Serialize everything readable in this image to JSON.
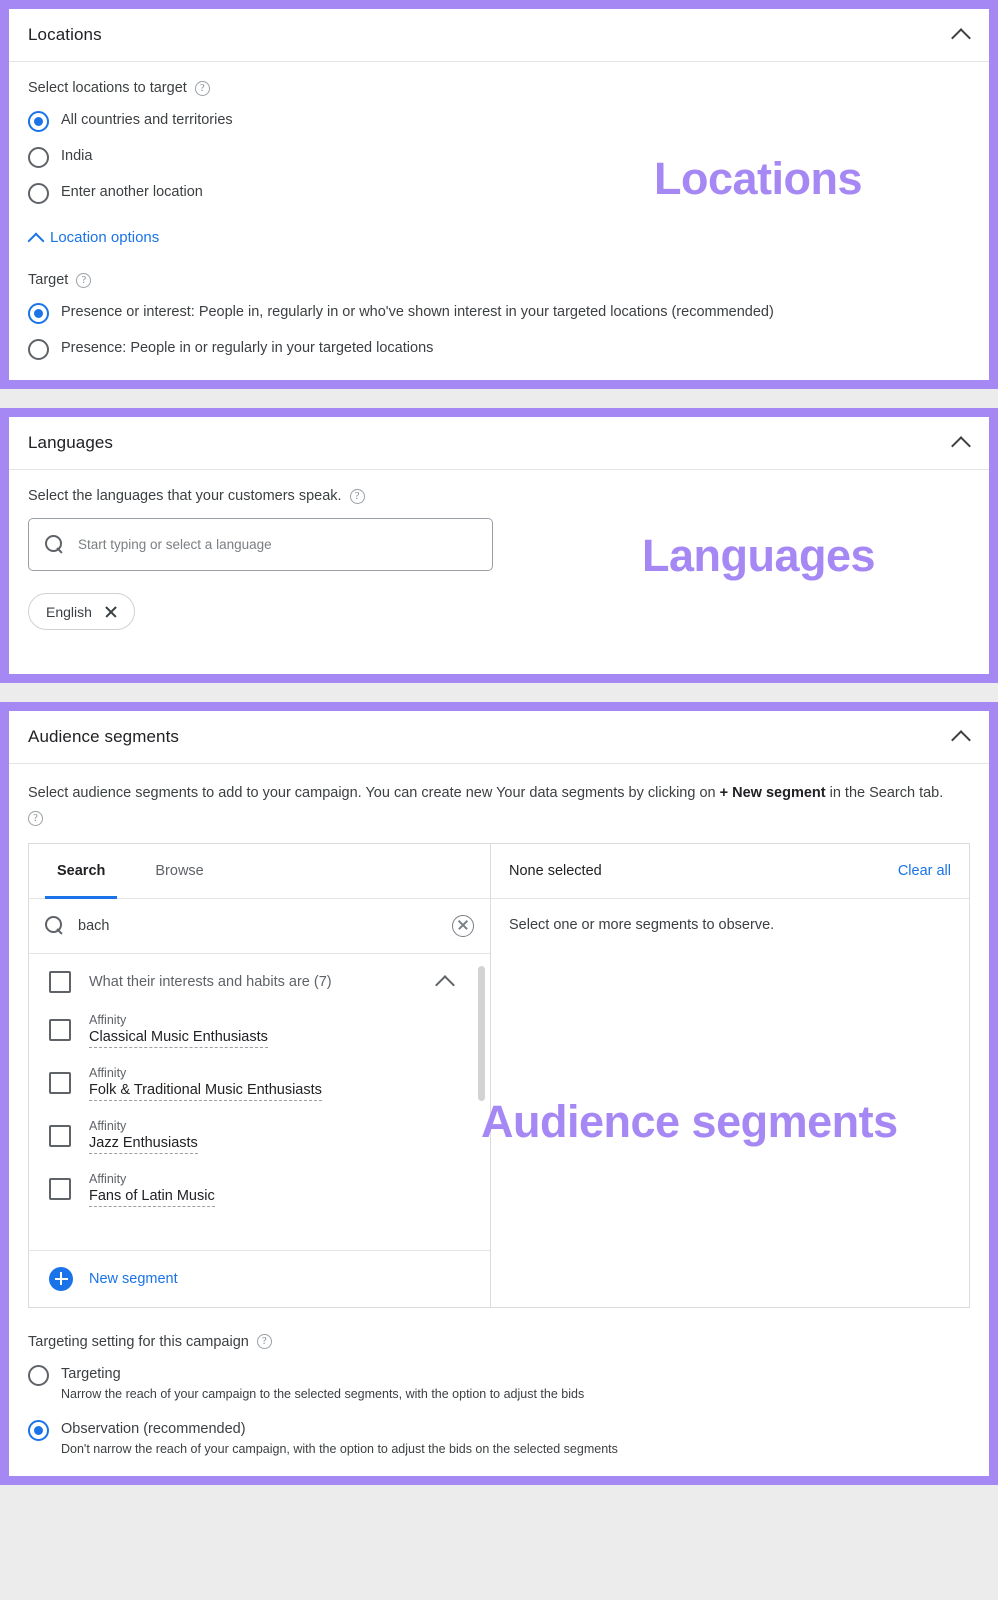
{
  "annotations": [
    {
      "text": "Locations",
      "size": 45
    },
    {
      "text": "Languages",
      "size": 45
    },
    {
      "text": "Audience segments",
      "size": 45
    }
  ],
  "accent_colors": {
    "highlight_purple": "#a688f5",
    "google_blue": "#1a73e8",
    "text_primary": "#202124",
    "text_secondary": "#5f6368",
    "page_background": "#ececec"
  },
  "locations": {
    "title": "Locations",
    "collapse_icon": "chevron-up-icon",
    "prompt": "Select locations to target",
    "help_icon": "help-icon",
    "options": [
      {
        "label": "All countries and territories",
        "selected": true
      },
      {
        "label": "India",
        "selected": false
      },
      {
        "label": "Enter another location",
        "selected": false
      }
    ],
    "location_options_link": "Location options",
    "location_options_icon": "chevron-up-icon",
    "target_label": "Target",
    "target_options": [
      {
        "label": "Presence or interest: People in, regularly in or who've shown interest in your targeted locations (recommended)",
        "selected": true
      },
      {
        "label": "Presence: People in or regularly in your targeted locations",
        "selected": false
      }
    ]
  },
  "languages": {
    "title": "Languages",
    "collapse_icon": "chevron-up-icon",
    "prompt": "Select the languages that your customers speak.",
    "help_icon": "help-icon",
    "search": {
      "icon": "search-icon",
      "value": "",
      "placeholder": "Start typing or select a language"
    },
    "chips": [
      {
        "label": "English",
        "remove_icon": "close-icon"
      }
    ]
  },
  "audience": {
    "title": "Audience segments",
    "collapse_icon": "chevron-up-icon",
    "description_part1": "Select audience segments to add to your campaign. You can create new Your data segments by clicking on ",
    "description_bold": "+ New segment",
    "description_part2": " in the Search tab.",
    "help_icon": "help-icon",
    "tabs": [
      {
        "label": "Search",
        "active": true
      },
      {
        "label": "Browse",
        "active": false
      }
    ],
    "search": {
      "icon": "search-icon",
      "value": "bach",
      "placeholder": "",
      "clear_icon": "clear-circle-icon"
    },
    "group": {
      "label": "What their interests and habits are (7)",
      "checked": false,
      "collapse_icon": "chevron-up-icon"
    },
    "segments": [
      {
        "kind": "Affinity",
        "name": "Classical Music Enthusiasts",
        "checked": false
      },
      {
        "kind": "Affinity",
        "name": "Folk & Traditional Music Enthusiasts",
        "checked": false
      },
      {
        "kind": "Affinity",
        "name": "Jazz Enthusiasts",
        "checked": false
      },
      {
        "kind": "Affinity",
        "name": "Fans of Latin Music",
        "checked": false
      }
    ],
    "new_segment": {
      "label": "New segment",
      "icon": "plus-circle-icon"
    },
    "selection_panel": {
      "status": "None selected",
      "clear_all": "Clear all",
      "empty_message": "Select one or more segments to observe."
    },
    "targeting_setting": {
      "label": "Targeting setting for this campaign",
      "help_icon": "help-icon",
      "options": [
        {
          "label": "Targeting",
          "sub": "Narrow the reach of your campaign to the selected segments, with the option to adjust the bids",
          "selected": false
        },
        {
          "label": "Observation (recommended)",
          "sub": "Don't narrow the reach of your campaign, with the option to adjust the bids on the selected segments",
          "selected": true
        }
      ]
    }
  }
}
